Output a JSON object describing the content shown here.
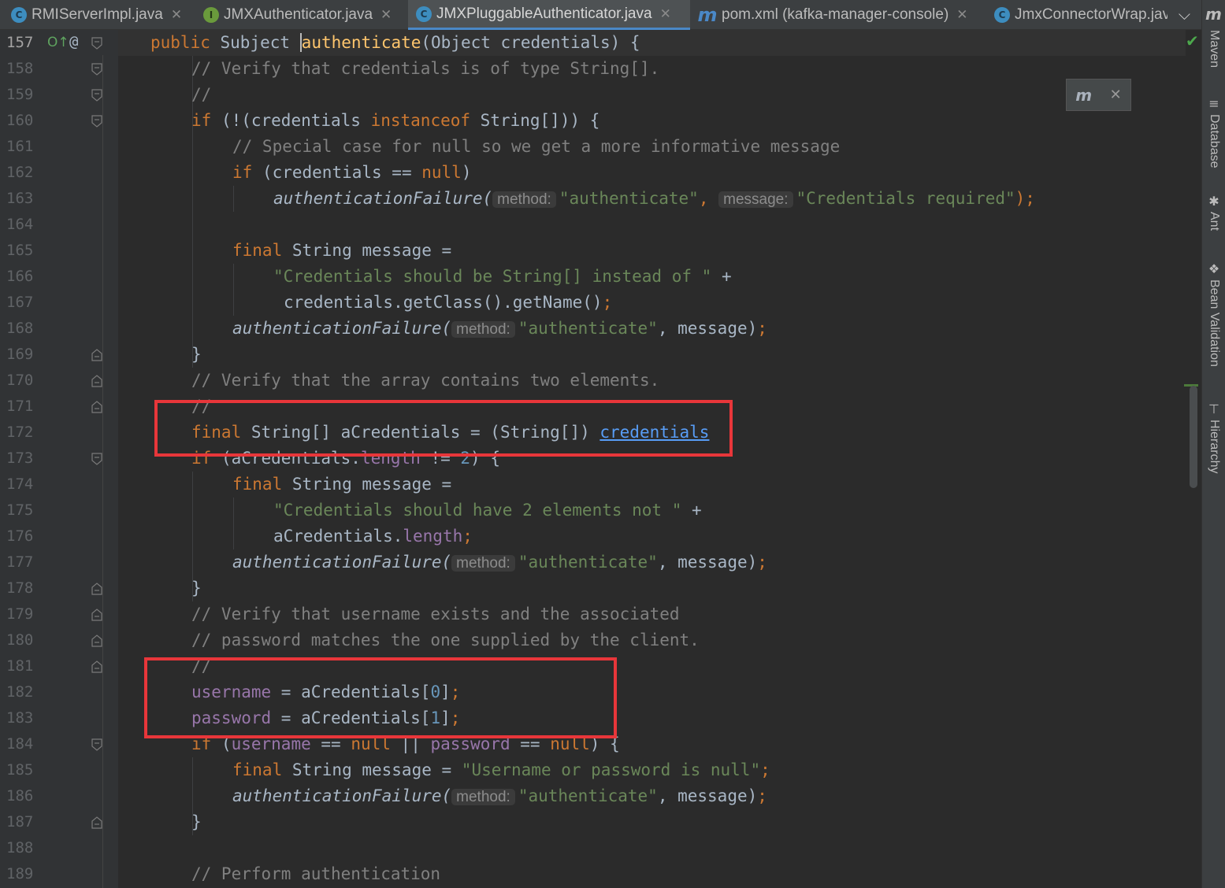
{
  "tabs": [
    {
      "label": "RMIServerImpl.java",
      "icon": "class-icon",
      "active": false
    },
    {
      "label": "JMXAuthenticator.java",
      "icon": "interface-icon",
      "active": false
    },
    {
      "label": "JMXPluggableAuthenticator.java",
      "icon": "class-icon",
      "active": true
    },
    {
      "label": "pom.xml (kafka-manager-console)",
      "icon": "maven-icon",
      "active": false
    },
    {
      "label": "JmxConnectorWrap.jav",
      "icon": "class-icon",
      "active": false
    }
  ],
  "gutter": {
    "line_numbers": [
      "157",
      "158",
      "159",
      "160",
      "161",
      "162",
      "163",
      "164",
      "165",
      "166",
      "167",
      "168",
      "169",
      "170",
      "171",
      "172",
      "173",
      "174",
      "175",
      "176",
      "177",
      "178",
      "179",
      "180",
      "181",
      "182",
      "183",
      "184",
      "185",
      "186",
      "187",
      "188",
      "189"
    ],
    "current_line": "157",
    "at_marker": "@"
  },
  "code": {
    "l157": {
      "a": "public ",
      "b": "Subject ",
      "c": "authenticate",
      "d": "(Object credentials) {"
    },
    "l158": {
      "a": "// Verify that credentials is of type String[]."
    },
    "l159": {
      "a": "//"
    },
    "l160": {
      "a": "if",
      "b": " (!(credentials ",
      "c": "instanceof",
      "d": " String[])) {"
    },
    "l161": {
      "a": "// Special case for null so we get a more informative message"
    },
    "l162": {
      "a": "if",
      "b": " (credentials == ",
      "c": "null",
      "d": ")"
    },
    "l163": {
      "a": "authenticationFailure(",
      "h1": "method:",
      "s1": "\"authenticate\"",
      "sep": ", ",
      "h2": "message:",
      "s2": "\"Credentials required\"",
      "e": ");"
    },
    "l165": {
      "a": "final",
      "b": " String message ="
    },
    "l166": {
      "a": "\"Credentials should be String[] instead of \"",
      "b": " +"
    },
    "l167": {
      "a": "credentials.getClass().getName()",
      "b": ";"
    },
    "l168": {
      "a": "authenticationFailure(",
      "h1": "method:",
      "s1": "\"authenticate\"",
      "b": ", message)",
      "e": ";"
    },
    "l169": {
      "a": "}"
    },
    "l170": {
      "a": "// Verify that the array contains two elements."
    },
    "l171": {
      "a": "//"
    },
    "l172": {
      "a": "final",
      "b": " String[] aCredentials = (String[]) ",
      "c": "credentials"
    },
    "l173": {
      "a": "if",
      "b": " (aCredentials.",
      "c": "length",
      "d": " != ",
      "e": "2",
      "f": ") {"
    },
    "l174": {
      "a": "final",
      "b": " String message ="
    },
    "l175": {
      "a": "\"Credentials should have 2 elements not \"",
      "b": " +"
    },
    "l176": {
      "a": "aCredentials.",
      "b": "length",
      "c": ";"
    },
    "l177": {
      "a": "authenticationFailure(",
      "h1": "method:",
      "s1": "\"authenticate\"",
      "b": ", message)",
      "e": ";"
    },
    "l178": {
      "a": "}"
    },
    "l179": {
      "a": "// Verify that username exists and the associated"
    },
    "l180": {
      "a": "// password matches the one supplied by the client."
    },
    "l181": {
      "a": "//"
    },
    "l182": {
      "a": "username",
      "b": " = aCredentials[",
      "c": "0",
      "d": "]",
      "e": ";"
    },
    "l183": {
      "a": "password",
      "b": " = aCredentials[",
      "c": "1",
      "d": "]",
      "e": ";"
    },
    "l184": {
      "a": "if",
      "b": " (",
      "c": "username",
      "d": " == ",
      "e": "null",
      "f": " || ",
      "g": "password",
      "h": " == ",
      "i": "null",
      "j": ") {"
    },
    "l185": {
      "a": "final",
      "b": " String message = ",
      "c": "\"Username or password is null\"",
      "d": ";"
    },
    "l186": {
      "a": "authenticationFailure(",
      "h1": "method:",
      "s1": "\"authenticate\"",
      "b": ", message)",
      "e": ";"
    },
    "l187": {
      "a": "}"
    },
    "l189": {
      "a": "// Perform authentication"
    }
  },
  "tool_windows": [
    "Maven",
    "Database",
    "Ant",
    "Bean Validation",
    "Hierarchy"
  ],
  "colors": {
    "keyword": "#cc7832",
    "string": "#6a8759",
    "comment": "#808080",
    "field": "#9876aa",
    "number": "#6897bb",
    "highlight_box": "#e8363a",
    "editor_bg": "#2b2b2b"
  }
}
